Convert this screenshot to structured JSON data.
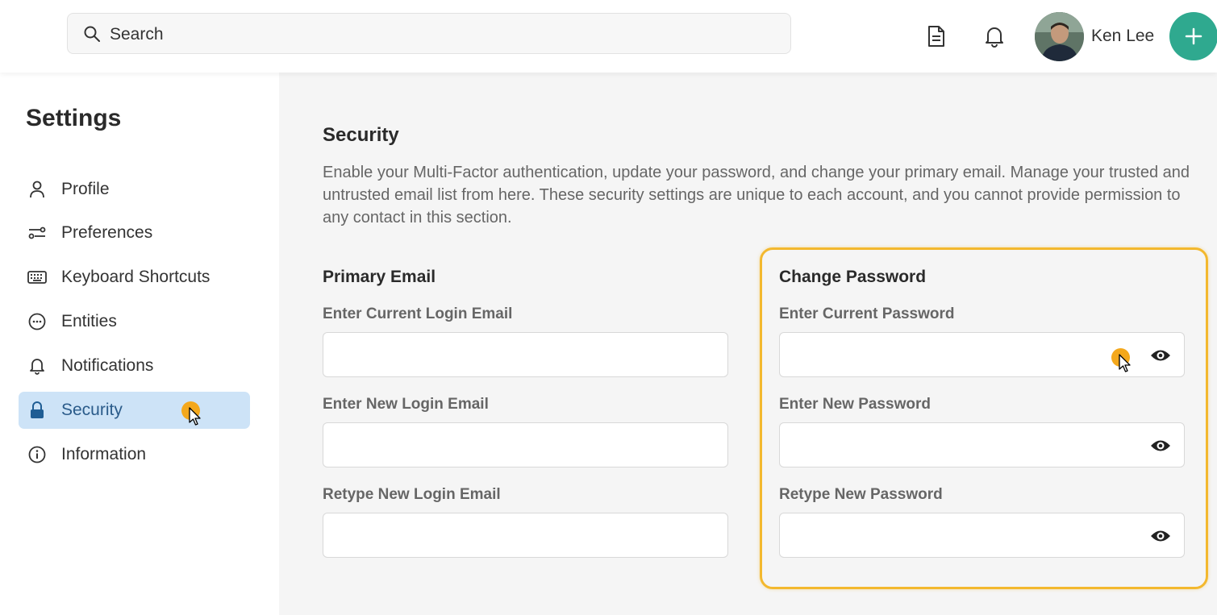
{
  "header": {
    "search_placeholder": "Search",
    "user_name": "Ken Lee",
    "icons": [
      "search-icon",
      "document-icon",
      "bell-icon",
      "plus-icon"
    ],
    "fab_color": "#2fa98f"
  },
  "sidebar": {
    "title": "Settings",
    "items": [
      {
        "label": "Profile",
        "icon": "person-icon"
      },
      {
        "label": "Preferences",
        "icon": "sliders-icon"
      },
      {
        "label": "Keyboard Shortcuts",
        "icon": "keyboard-icon"
      },
      {
        "label": "Entities",
        "icon": "dots-circle-icon"
      },
      {
        "label": "Notifications",
        "icon": "bell-icon"
      },
      {
        "label": "Security",
        "icon": "lock-icon",
        "active": true
      },
      {
        "label": "Information",
        "icon": "info-icon"
      }
    ],
    "active_color": "#cde3f7"
  },
  "main": {
    "title": "Security",
    "description": "Enable your Multi-Factor authentication, update your password, and change your primary email. Manage your trusted and untrusted email list from here. These security settings are unique to each account, and you cannot provide permission to any contact in this section.",
    "primary_email": {
      "heading": "Primary Email",
      "fields": [
        {
          "label": "Enter Current Login Email",
          "value": ""
        },
        {
          "label": "Enter New Login Email",
          "value": ""
        },
        {
          "label": "Retype New Login Email",
          "value": ""
        }
      ]
    },
    "change_password": {
      "heading": "Change Password",
      "fields": [
        {
          "label": "Enter Current Password",
          "value": ""
        },
        {
          "label": "Enter New Password",
          "value": ""
        },
        {
          "label": "Retype New Password",
          "value": ""
        }
      ],
      "highlight_color": "#f3b82e"
    }
  }
}
